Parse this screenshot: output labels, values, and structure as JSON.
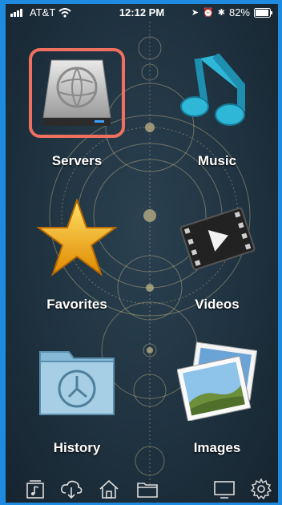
{
  "status_bar": {
    "carrier": "AT&T",
    "time": "12:12 PM",
    "battery": "82%"
  },
  "tiles": [
    {
      "label": "Servers",
      "icon": "server-drive-icon"
    },
    {
      "label": "Music",
      "icon": "music-note-icon"
    },
    {
      "label": "Favorites",
      "icon": "star-icon"
    },
    {
      "label": "Videos",
      "icon": "film-clip-icon"
    },
    {
      "label": "History",
      "icon": "clock-folder-icon"
    },
    {
      "label": "Images",
      "icon": "photos-icon"
    }
  ],
  "toolbar": {
    "items": [
      "music-library-icon",
      "cloud-download-icon",
      "home-icon",
      "folder-icon",
      "tv-icon",
      "gear-icon"
    ]
  },
  "colors": {
    "frame": "#1e8be0",
    "highlight": "#f07060",
    "background": "#1f3240"
  }
}
